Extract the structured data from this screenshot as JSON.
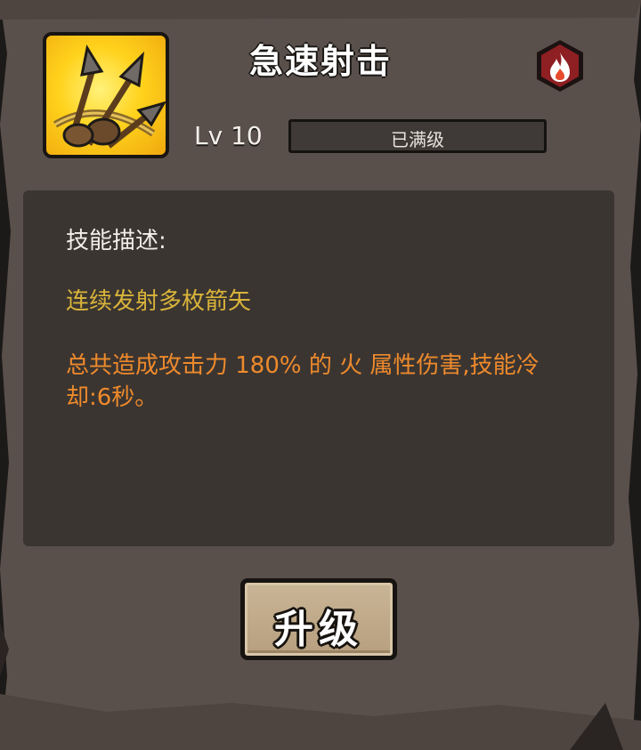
{
  "skill": {
    "title": "急速射击",
    "icon": "arrows-icon",
    "element_icon": "fire-icon",
    "element_badge_color": "#8e1f22"
  },
  "level": {
    "label": "Lv 10",
    "status": "已满级",
    "progress": 1.0
  },
  "description": {
    "heading": "技能描述:",
    "summary": "连续发射多枚箭矢",
    "detail": "总共造成攻击力 180% 的 火 属性伤害,技能冷却:6秒。"
  },
  "actions": {
    "upgrade_label": "升级"
  },
  "colors": {
    "panel": "#5a504b",
    "desc_box": "#3b3531",
    "summary_text": "#d9b43a",
    "detail_text": "#ee8a2c",
    "button": "#c2ad8d"
  }
}
